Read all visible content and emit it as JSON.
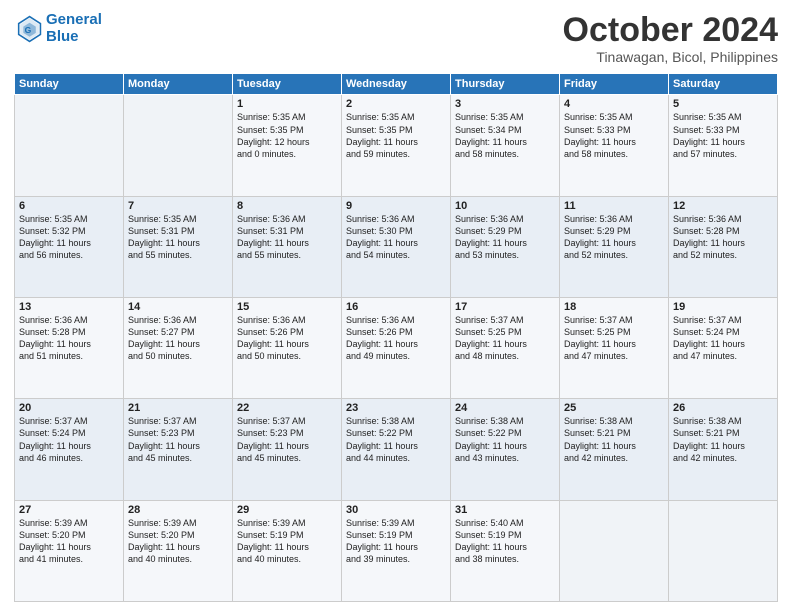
{
  "logo": {
    "line1": "General",
    "line2": "Blue"
  },
  "title": "October 2024",
  "location": "Tinawagan, Bicol, Philippines",
  "header_days": [
    "Sunday",
    "Monday",
    "Tuesday",
    "Wednesday",
    "Thursday",
    "Friday",
    "Saturday"
  ],
  "weeks": [
    [
      {
        "day": "",
        "text": ""
      },
      {
        "day": "",
        "text": ""
      },
      {
        "day": "1",
        "text": "Sunrise: 5:35 AM\nSunset: 5:35 PM\nDaylight: 12 hours\nand 0 minutes."
      },
      {
        "day": "2",
        "text": "Sunrise: 5:35 AM\nSunset: 5:35 PM\nDaylight: 11 hours\nand 59 minutes."
      },
      {
        "day": "3",
        "text": "Sunrise: 5:35 AM\nSunset: 5:34 PM\nDaylight: 11 hours\nand 58 minutes."
      },
      {
        "day": "4",
        "text": "Sunrise: 5:35 AM\nSunset: 5:33 PM\nDaylight: 11 hours\nand 58 minutes."
      },
      {
        "day": "5",
        "text": "Sunrise: 5:35 AM\nSunset: 5:33 PM\nDaylight: 11 hours\nand 57 minutes."
      }
    ],
    [
      {
        "day": "6",
        "text": "Sunrise: 5:35 AM\nSunset: 5:32 PM\nDaylight: 11 hours\nand 56 minutes."
      },
      {
        "day": "7",
        "text": "Sunrise: 5:35 AM\nSunset: 5:31 PM\nDaylight: 11 hours\nand 55 minutes."
      },
      {
        "day": "8",
        "text": "Sunrise: 5:36 AM\nSunset: 5:31 PM\nDaylight: 11 hours\nand 55 minutes."
      },
      {
        "day": "9",
        "text": "Sunrise: 5:36 AM\nSunset: 5:30 PM\nDaylight: 11 hours\nand 54 minutes."
      },
      {
        "day": "10",
        "text": "Sunrise: 5:36 AM\nSunset: 5:29 PM\nDaylight: 11 hours\nand 53 minutes."
      },
      {
        "day": "11",
        "text": "Sunrise: 5:36 AM\nSunset: 5:29 PM\nDaylight: 11 hours\nand 52 minutes."
      },
      {
        "day": "12",
        "text": "Sunrise: 5:36 AM\nSunset: 5:28 PM\nDaylight: 11 hours\nand 52 minutes."
      }
    ],
    [
      {
        "day": "13",
        "text": "Sunrise: 5:36 AM\nSunset: 5:28 PM\nDaylight: 11 hours\nand 51 minutes."
      },
      {
        "day": "14",
        "text": "Sunrise: 5:36 AM\nSunset: 5:27 PM\nDaylight: 11 hours\nand 50 minutes."
      },
      {
        "day": "15",
        "text": "Sunrise: 5:36 AM\nSunset: 5:26 PM\nDaylight: 11 hours\nand 50 minutes."
      },
      {
        "day": "16",
        "text": "Sunrise: 5:36 AM\nSunset: 5:26 PM\nDaylight: 11 hours\nand 49 minutes."
      },
      {
        "day": "17",
        "text": "Sunrise: 5:37 AM\nSunset: 5:25 PM\nDaylight: 11 hours\nand 48 minutes."
      },
      {
        "day": "18",
        "text": "Sunrise: 5:37 AM\nSunset: 5:25 PM\nDaylight: 11 hours\nand 47 minutes."
      },
      {
        "day": "19",
        "text": "Sunrise: 5:37 AM\nSunset: 5:24 PM\nDaylight: 11 hours\nand 47 minutes."
      }
    ],
    [
      {
        "day": "20",
        "text": "Sunrise: 5:37 AM\nSunset: 5:24 PM\nDaylight: 11 hours\nand 46 minutes."
      },
      {
        "day": "21",
        "text": "Sunrise: 5:37 AM\nSunset: 5:23 PM\nDaylight: 11 hours\nand 45 minutes."
      },
      {
        "day": "22",
        "text": "Sunrise: 5:37 AM\nSunset: 5:23 PM\nDaylight: 11 hours\nand 45 minutes."
      },
      {
        "day": "23",
        "text": "Sunrise: 5:38 AM\nSunset: 5:22 PM\nDaylight: 11 hours\nand 44 minutes."
      },
      {
        "day": "24",
        "text": "Sunrise: 5:38 AM\nSunset: 5:22 PM\nDaylight: 11 hours\nand 43 minutes."
      },
      {
        "day": "25",
        "text": "Sunrise: 5:38 AM\nSunset: 5:21 PM\nDaylight: 11 hours\nand 42 minutes."
      },
      {
        "day": "26",
        "text": "Sunrise: 5:38 AM\nSunset: 5:21 PM\nDaylight: 11 hours\nand 42 minutes."
      }
    ],
    [
      {
        "day": "27",
        "text": "Sunrise: 5:39 AM\nSunset: 5:20 PM\nDaylight: 11 hours\nand 41 minutes."
      },
      {
        "day": "28",
        "text": "Sunrise: 5:39 AM\nSunset: 5:20 PM\nDaylight: 11 hours\nand 40 minutes."
      },
      {
        "day": "29",
        "text": "Sunrise: 5:39 AM\nSunset: 5:19 PM\nDaylight: 11 hours\nand 40 minutes."
      },
      {
        "day": "30",
        "text": "Sunrise: 5:39 AM\nSunset: 5:19 PM\nDaylight: 11 hours\nand 39 minutes."
      },
      {
        "day": "31",
        "text": "Sunrise: 5:40 AM\nSunset: 5:19 PM\nDaylight: 11 hours\nand 38 minutes."
      },
      {
        "day": "",
        "text": ""
      },
      {
        "day": "",
        "text": ""
      }
    ]
  ]
}
